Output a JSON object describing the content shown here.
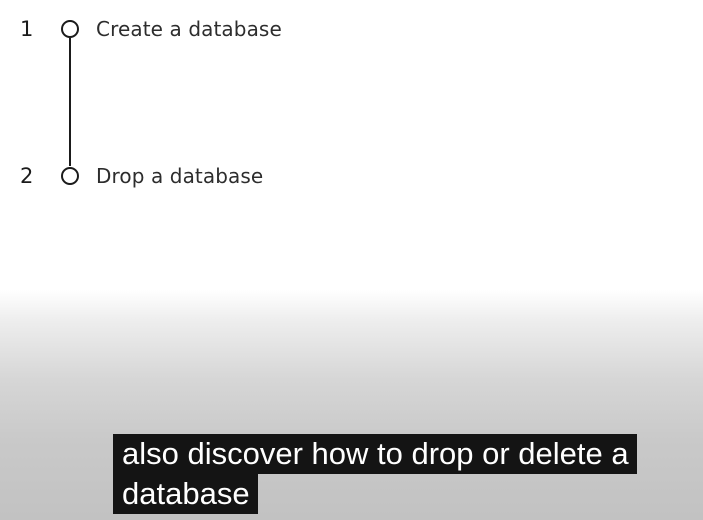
{
  "steps": [
    {
      "number": "1",
      "label": "Create a database",
      "state": "incomplete"
    },
    {
      "number": "2",
      "label": "Drop a database",
      "state": "incomplete"
    }
  ],
  "caption": {
    "lines": [
      "also discover how to drop or delete a",
      "database"
    ]
  },
  "colors": {
    "text_dark": "#1b1b1b",
    "caption_background": "#141414",
    "caption_text": "#ffffff"
  },
  "icons": {
    "step_node": "empty-circle"
  }
}
